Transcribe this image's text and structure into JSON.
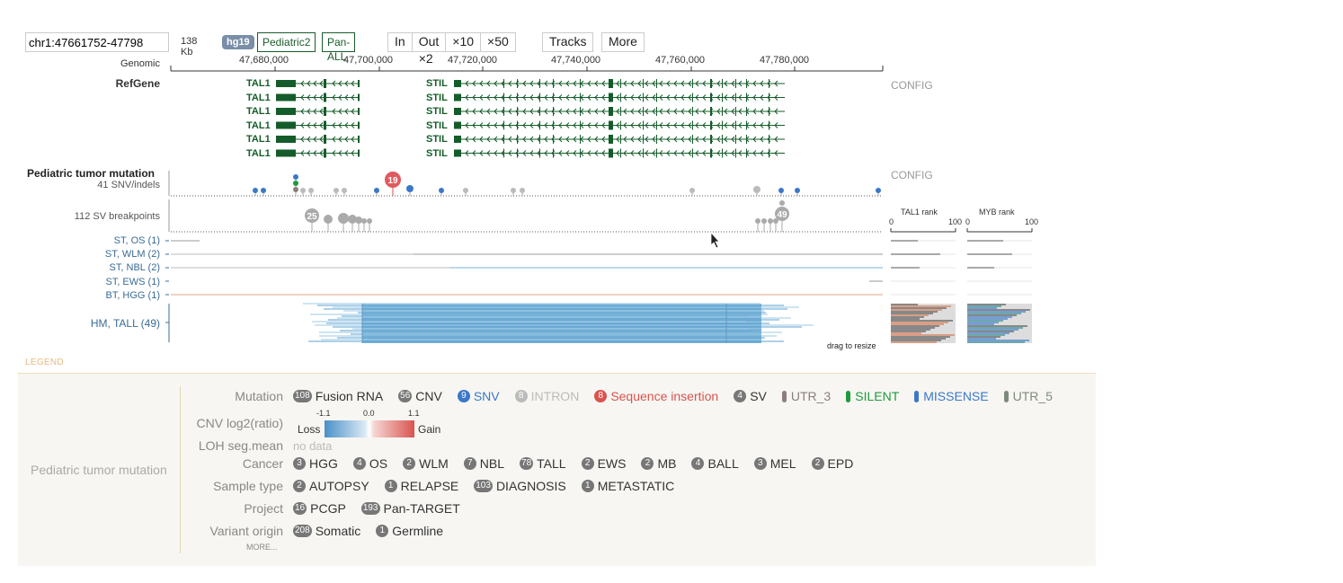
{
  "toolbar": {
    "coordinate_value": "chr1:47661752-47798",
    "span_label": "138 Kb",
    "genome_badge": "hg19",
    "dataset1": "Pediatric2",
    "dataset2": "Pan-ALL",
    "zoom_in": "In",
    "zoom_out": "Out ×2",
    "zoom_x10": "×10",
    "zoom_x50": "×50",
    "tracks_label": "Tracks",
    "more_label": "More"
  },
  "ruler": {
    "label": "Genomic",
    "ticks": [
      "47,680,000",
      "47,700,000",
      "47,720,000",
      "47,740,000",
      "47,760,000",
      "47,780,000"
    ]
  },
  "refgene": {
    "label": "RefGene",
    "config": "CONFIG",
    "gene1": "TAL1",
    "gene2": "STIL"
  },
  "mutation_track": {
    "title": "Pediatric tumor mutation",
    "config": "CONFIG",
    "snv_label": "41 SNV/indels",
    "sv_label": "112 SV breakpoints",
    "snv_bubble": "19",
    "sv_bubble1": "25",
    "sv_bubble2": "49",
    "drag_hint": "drag to resize",
    "rank1_title": "TAL1 rank",
    "rank2_title": "MYB rank",
    "rank_min": "0",
    "rank_max": "100",
    "groups": [
      {
        "label": "ST, OS (1)"
      },
      {
        "label": "ST, WLM (2)"
      },
      {
        "label": "ST, NBL (2)"
      },
      {
        "label": "ST, EWS (1)"
      },
      {
        "label": "BT, HGG (1)"
      },
      {
        "label": "HM, TALL (49)"
      }
    ]
  },
  "legend": {
    "header": "LEGEND",
    "title": "Pediatric tumor mutation",
    "mutation_label": "Mutation",
    "mutation_items": [
      {
        "count": "108",
        "name": "Fusion RNA",
        "color": "#333333"
      },
      {
        "count": "56",
        "name": "CNV",
        "color": "#333333"
      },
      {
        "count": "9",
        "name": "SNV",
        "color": "#3a78c9"
      },
      {
        "count": "8",
        "name": "INTRON",
        "color": "#bbbbbb"
      },
      {
        "count": "8",
        "name": "Sequence insertion",
        "color": "#d9534f"
      },
      {
        "count": "4",
        "name": "SV",
        "color": "#333333"
      }
    ],
    "mutation_bars": [
      {
        "name": "UTR_3",
        "color": "#8c7e7e"
      },
      {
        "name": "SILENT",
        "color": "#1e9a3e"
      },
      {
        "name": "MISSENSE",
        "color": "#3a78c9"
      },
      {
        "name": "UTR_5",
        "color": "#7d8b7d"
      }
    ],
    "cnv_label": "CNV log2(ratio)",
    "cnv_min": "-1.1",
    "cnv_mid": "0.0",
    "cnv_max": "1.1",
    "cnv_loss": "Loss",
    "cnv_gain": "Gain",
    "loh_label": "LOH seg.mean",
    "loh_value": "no data",
    "cancer_label": "Cancer",
    "cancer_items": [
      {
        "count": "3",
        "name": "HGG"
      },
      {
        "count": "4",
        "name": "OS"
      },
      {
        "count": "2",
        "name": "WLM"
      },
      {
        "count": "7",
        "name": "NBL"
      },
      {
        "count": "78",
        "name": "TALL"
      },
      {
        "count": "2",
        "name": "EWS"
      },
      {
        "count": "2",
        "name": "MB"
      },
      {
        "count": "4",
        "name": "BALL"
      },
      {
        "count": "3",
        "name": "MEL"
      },
      {
        "count": "2",
        "name": "EPD"
      }
    ],
    "sample_label": "Sample type",
    "sample_items": [
      {
        "count": "2",
        "name": "AUTOPSY"
      },
      {
        "count": "1",
        "name": "RELAPSE"
      },
      {
        "count": "103",
        "name": "DIAGNOSIS"
      },
      {
        "count": "1",
        "name": "METASTATIC"
      }
    ],
    "project_label": "Project",
    "project_items": [
      {
        "count": "16",
        "name": "PCGP"
      },
      {
        "count": "193",
        "name": "Pan-TARGET"
      }
    ],
    "origin_label": "Variant origin",
    "origin_items": [
      {
        "count": "208",
        "name": "Somatic"
      },
      {
        "count": "1",
        "name": "Germline"
      }
    ],
    "more_label": "MORE..."
  }
}
